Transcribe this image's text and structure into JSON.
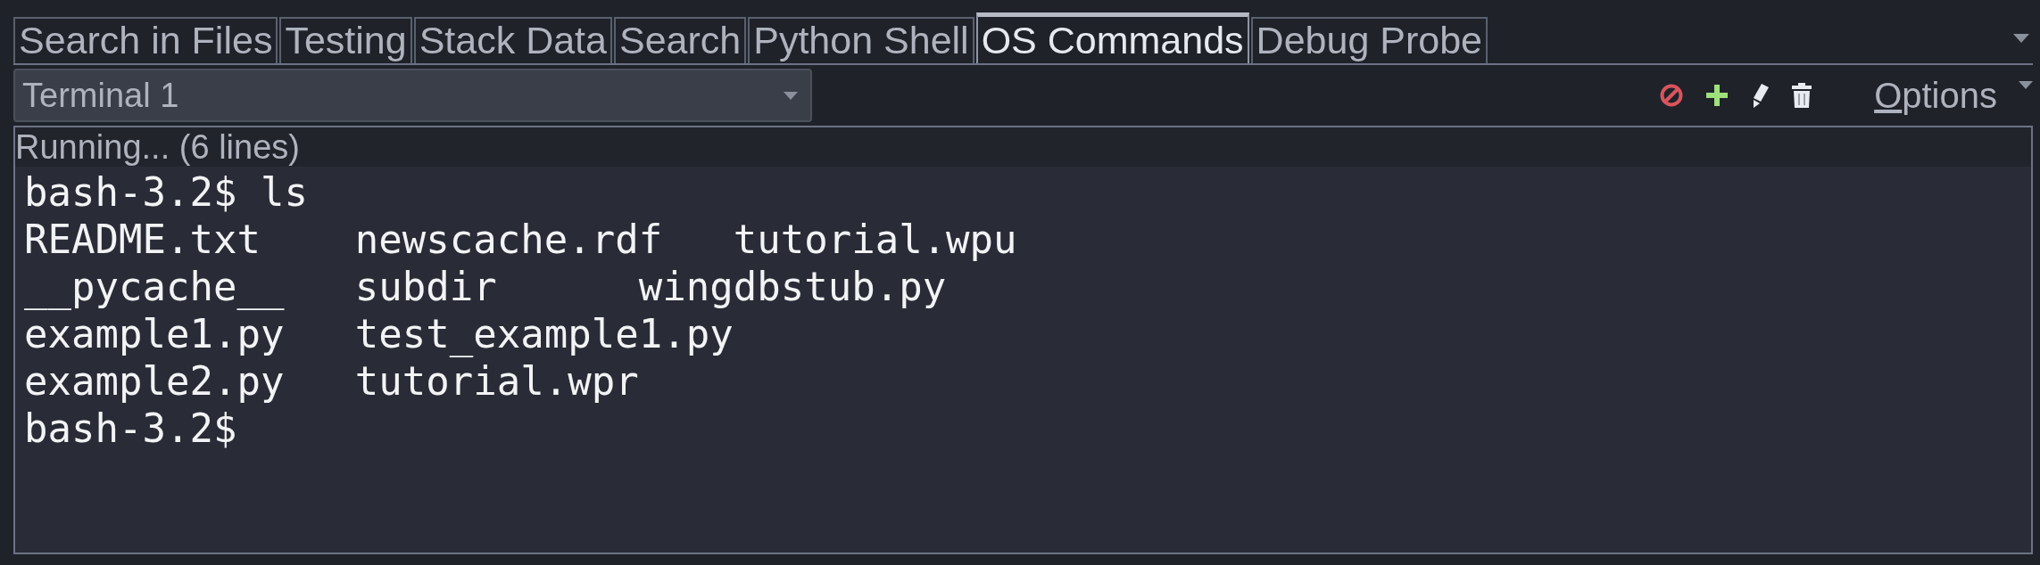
{
  "tabs": [
    {
      "label": "Search in Files",
      "selected": false
    },
    {
      "label": "Testing",
      "selected": false
    },
    {
      "label": "Stack Data",
      "selected": false
    },
    {
      "label": "Search",
      "selected": false
    },
    {
      "label": "Python Shell",
      "selected": false
    },
    {
      "label": "OS Commands",
      "selected": true
    },
    {
      "label": "Debug Probe",
      "selected": false
    }
  ],
  "terminal_selector": {
    "value": "Terminal 1"
  },
  "toolbar": {
    "options_label": "Options"
  },
  "status": "Running... (6 lines)",
  "terminal": {
    "lines": [
      "bash-3.2$ ls",
      "README.txt    newscache.rdf   tutorial.wpu",
      "__pycache__   subdir      wingdbstub.py",
      "example1.py   test_example1.py",
      "example2.py   tutorial.wpr",
      "bash-3.2$"
    ]
  }
}
